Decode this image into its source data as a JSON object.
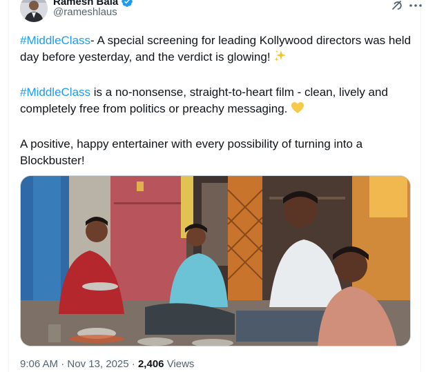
{
  "author": {
    "display_name": "Ramesh Bala",
    "handle": "@rameshlaus",
    "verified_color": "#1d9bf0"
  },
  "header_actions": {
    "grok_icon": "grok-icon",
    "more_icon": "more-horizontal-icon"
  },
  "tweet": {
    "p1_hashtag": "#MiddleClass",
    "p1_text": "- A special screening for leading Kollywood directors was held day before yesterday, and the verdict is glowing!",
    "p1_emoji": "sparkles-emoji",
    "p2_hashtag": "#MiddleClass",
    "p2_text": " is a no-nonsense, straight-to-heart film - clean, lively and completely free from politics or preachy messaging.",
    "p2_emoji": "yellow-heart-emoji",
    "p3_text": "A positive, happy entertainer with every possibility of turning into a Blockbuster!"
  },
  "media": {
    "description_icon": "family-meal-photo"
  },
  "meta": {
    "time": "9:06 AM",
    "separator": "·",
    "date": "Nov 13, 2025",
    "views_count": "2,406",
    "views_label": "Views"
  },
  "colors": {
    "hashtag": "#1d9bf0",
    "secondary_text": "#536471",
    "primary_text": "#0f1419"
  }
}
